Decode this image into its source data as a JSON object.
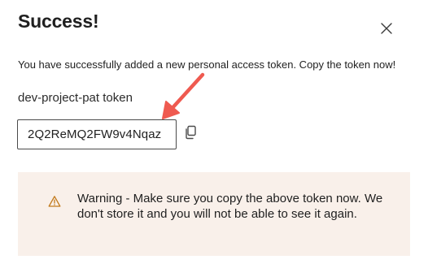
{
  "dialog": {
    "title": "Success!",
    "close_icon": "close-icon",
    "message": "You have successfully added a new personal access token. Copy the token now!",
    "token_name": "dev-project-pat token",
    "token_value": "2Q2ReMQ2FW9v4Nqaz",
    "copy_icon": "copy-icon",
    "annotation_arrow_color": "#ef5a50",
    "warning": {
      "icon": "warning-icon",
      "text": "Warning - Make sure you copy the above token now. We don't store it and you will not be able to see it again.",
      "background": "#f9f0ea",
      "icon_color": "#c27a1c"
    }
  }
}
